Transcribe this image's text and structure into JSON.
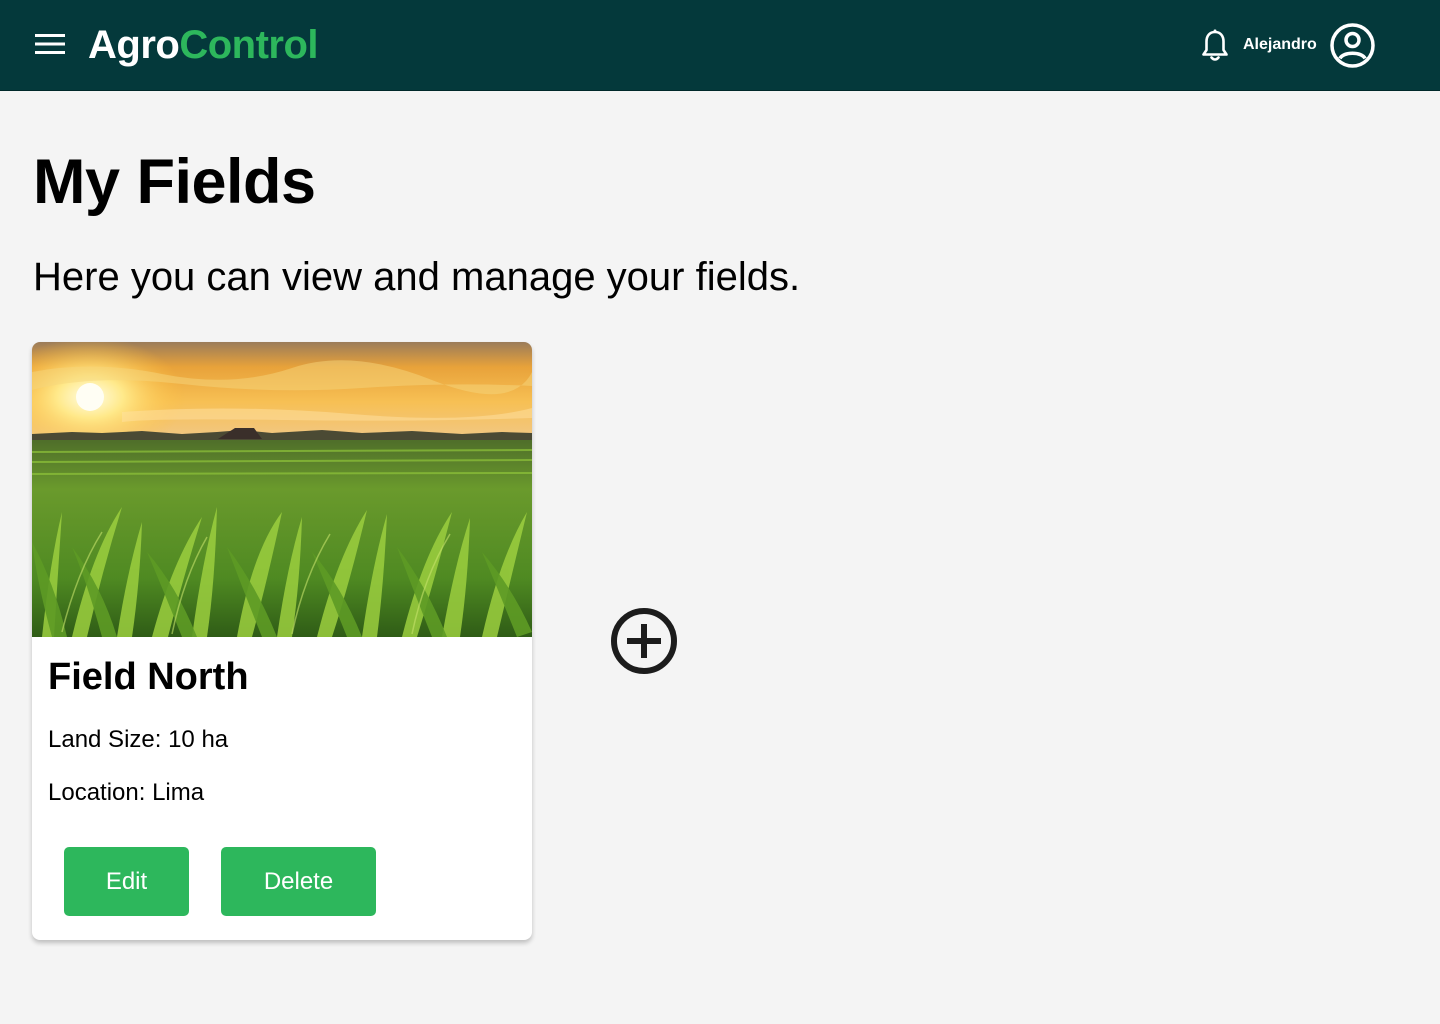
{
  "header": {
    "brand_part1": "Agro",
    "brand_part2": "Control",
    "username": "Alejandro",
    "background_color": "#04393b",
    "accent_color": "#2db75c",
    "icons": {
      "menu": "hamburger-menu-icon",
      "notifications": "bell-icon",
      "profile": "user-circle-icon"
    }
  },
  "main": {
    "title": "My Fields",
    "subtitle": "Here you can view and manage your fields."
  },
  "fields": [
    {
      "name": "Field North",
      "land_size": "Land Size: 10 ha",
      "location": "Location: Lima",
      "edit_label": "Edit",
      "delete_label": "Delete"
    }
  ],
  "add_field": {
    "icon": "plus-circle-icon"
  },
  "colors": {
    "button": "#2db75c",
    "page_bg": "#f4f4f4",
    "card_bg": "#ffffff"
  }
}
